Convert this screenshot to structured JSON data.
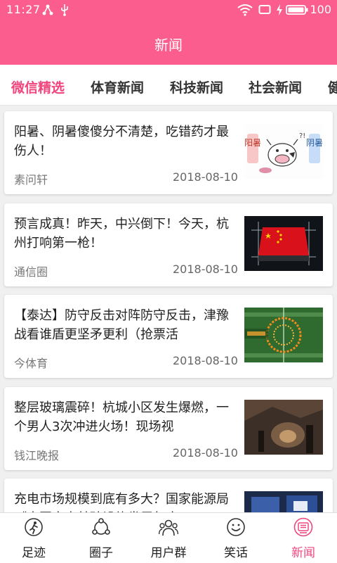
{
  "status_bar": {
    "time": "11:27",
    "battery": "100"
  },
  "app_bar": {
    "title": "新闻"
  },
  "tabs": [
    {
      "label": "微信精选"
    },
    {
      "label": "体育新闻"
    },
    {
      "label": "科技新闻"
    },
    {
      "label": "社会新闻"
    },
    {
      "label": "健"
    }
  ],
  "news": [
    {
      "title": "阳暑、阴暑傻傻分不清楚，吃错药才最伤人！",
      "source": "素问轩",
      "date": "2018-08-10",
      "thumb_text_left": "阳暑",
      "thumb_text_right": "阴暑"
    },
    {
      "title": "预言成真！昨天，中兴倒下！今天，杭州打响第一枪！",
      "source": "通信圈",
      "date": "2018-08-10"
    },
    {
      "title": "【泰达】防守反击对阵防守反击，津豫战看谁盾更坚矛更利（抢票活",
      "source": "今体育",
      "date": "2018-08-10"
    },
    {
      "title": "整层玻璃震碎！杭城小区发生爆燃，一个男人3次冲进火场！现场视",
      "source": "钱江晚报",
      "date": "2018-08-10"
    },
    {
      "title": "充电市场规模到底有多大？国家能源局《中国充电基础设施发展年度",
      "source": "",
      "date": ""
    }
  ],
  "bottom_nav": [
    {
      "label": "足迹",
      "icon": "footprint-icon"
    },
    {
      "label": "圈子",
      "icon": "circle-icon"
    },
    {
      "label": "用户群",
      "icon": "user-group-icon"
    },
    {
      "label": "笑话",
      "icon": "smiley-icon"
    },
    {
      "label": "新闻",
      "icon": "news-icon"
    }
  ],
  "colors": {
    "accent": "#fb5e8e",
    "active_tab": "#f0467e"
  }
}
